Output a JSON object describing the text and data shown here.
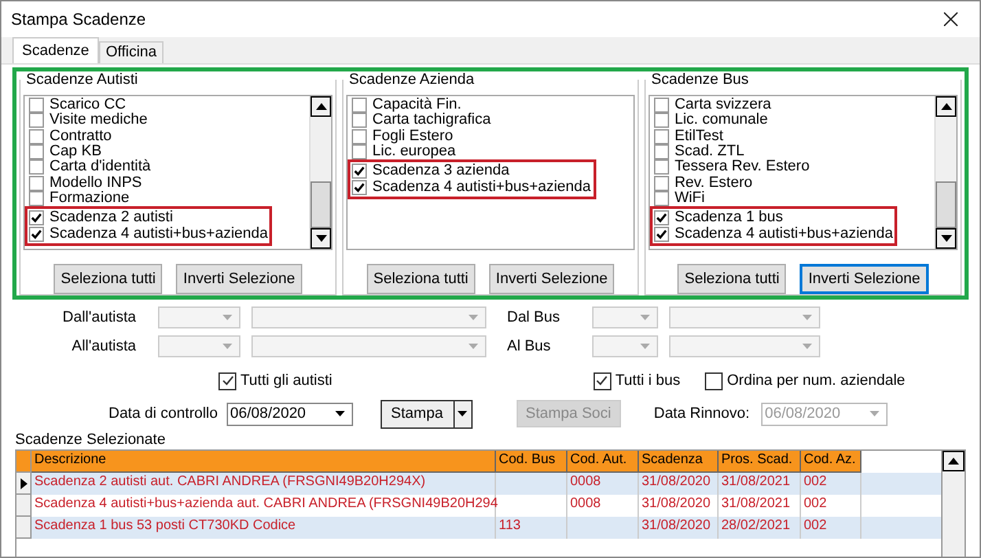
{
  "window": {
    "title": "Stampa Scadenze"
  },
  "tabs": [
    {
      "label": "Scadenze",
      "selected": true
    },
    {
      "label": "Officina",
      "selected": false
    }
  ],
  "groups": [
    {
      "title": "Scadenze Autisti",
      "items": [
        {
          "label": "Scarico CC",
          "checked": false
        },
        {
          "label": "Visite mediche",
          "checked": false
        },
        {
          "label": "Contratto",
          "checked": false
        },
        {
          "label": "Cap KB",
          "checked": false
        },
        {
          "label": "Carta d'identità",
          "checked": false
        },
        {
          "label": "Modello INPS",
          "checked": false
        },
        {
          "label": "Formazione",
          "checked": false
        },
        {
          "label": "Scadenza 2 autisti",
          "checked": true
        },
        {
          "label": "Scadenza 4 autisti+bus+azienda",
          "checked": true
        }
      ],
      "buttons": [
        {
          "label": "Seleziona tutti",
          "focused": false
        },
        {
          "label": "Inverti Selezione",
          "focused": false
        }
      ]
    },
    {
      "title": "Scadenze Azienda",
      "items": [
        {
          "label": "Capacità Fin.",
          "checked": false
        },
        {
          "label": "Carta tachigrafica",
          "checked": false
        },
        {
          "label": "Fogli Estero",
          "checked": false
        },
        {
          "label": "Lic. europea",
          "checked": false
        },
        {
          "label": "Scadenza 3 azienda",
          "checked": true
        },
        {
          "label": "Scadenza 4 autisti+bus+azienda",
          "checked": true
        }
      ],
      "buttons": [
        {
          "label": "Seleziona tutti",
          "focused": false
        },
        {
          "label": "Inverti Selezione",
          "focused": false
        }
      ]
    },
    {
      "title": "Scadenze Bus",
      "items": [
        {
          "label": "Carta svizzera",
          "checked": false
        },
        {
          "label": "Lic. comunale",
          "checked": false
        },
        {
          "label": "EtilTest",
          "checked": false
        },
        {
          "label": "Scad. ZTL",
          "checked": false
        },
        {
          "label": "Tessera Rev. Estero",
          "checked": false
        },
        {
          "label": "Rev. Estero",
          "checked": false
        },
        {
          "label": "WiFi",
          "checked": false
        },
        {
          "label": "Scadenza 1 bus",
          "checked": true
        },
        {
          "label": "Scadenza 4 autisti+bus+azienda",
          "checked": true
        }
      ],
      "buttons": [
        {
          "label": "Seleziona tutti",
          "focused": false
        },
        {
          "label": "Inverti Selezione",
          "focused": true
        }
      ]
    }
  ],
  "filters": {
    "left": [
      "Dall'autista",
      "All'autista"
    ],
    "right": [
      "Dal Bus",
      "Al Bus"
    ]
  },
  "options": [
    {
      "label": "Tutti gli autisti",
      "checked": true
    },
    {
      "label": "Tutti i bus",
      "checked": true
    },
    {
      "label": "Ordina per num. aziendale",
      "checked": false
    }
  ],
  "control_date": {
    "label": "Data di controllo",
    "value": "06/08/2020"
  },
  "print_button": {
    "label": "Stampa"
  },
  "members_button": {
    "label": "Stampa Soci",
    "disabled": true
  },
  "renewal_date": {
    "label": "Data Rinnovo:",
    "value": "06/08/2020",
    "disabled": true
  },
  "table": {
    "title": "Scadenze Selezionate",
    "columns": [
      "Descrizione",
      "Cod. Bus",
      "Cod. Aut.",
      "Scadenza",
      "Pros. Scad.",
      "Cod. Az."
    ],
    "rows": [
      {
        "cells": [
          "Scadenza 2 autisti aut. CABRI ANDREA (FRSGNI49B20H294X)",
          "",
          "0008",
          "31/08/2020",
          "31/08/2021",
          "002"
        ],
        "selected": true
      },
      {
        "cells": [
          "Scadenza 4 autisti+bus+azienda aut. CABRI ANDREA (FRSGNI49B20H294",
          "",
          "0008",
          "31/08/2020",
          "31/08/2021",
          "002"
        ],
        "selected": false
      },
      {
        "cells": [
          "Scadenza 1 bus 53 posti CT730KD Codice",
          "113",
          "",
          "31/08/2020",
          "28/02/2021",
          "002"
        ],
        "selected": false
      }
    ]
  }
}
